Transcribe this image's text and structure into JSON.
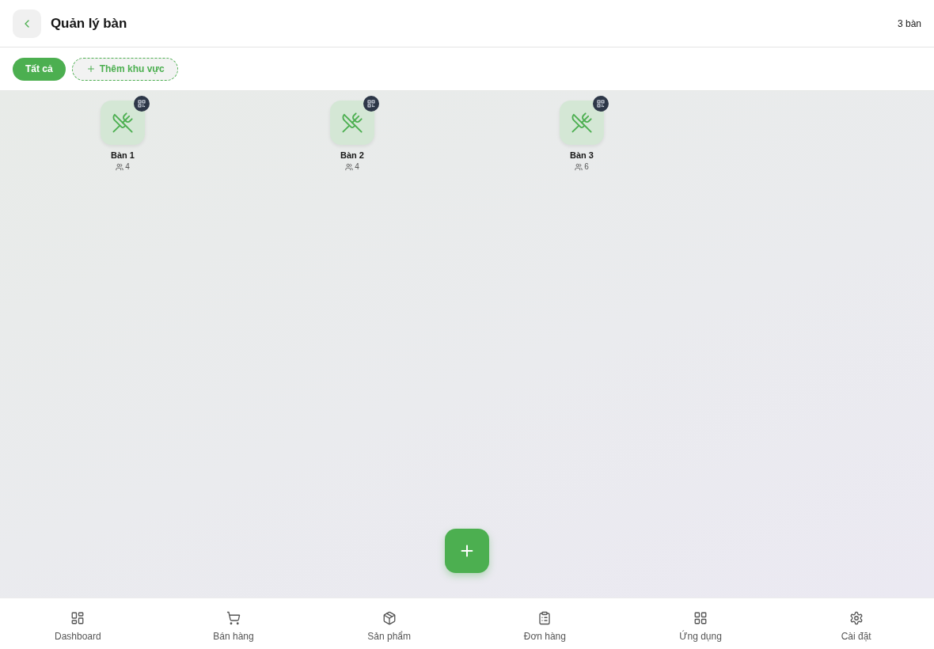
{
  "header": {
    "title": "Quản lý bàn",
    "table_count": "3 bàn"
  },
  "area_tabs": [
    {
      "label": "Tất cả",
      "selected": true
    }
  ],
  "add_area_button": {
    "label": "Thêm khu vực"
  },
  "tables": [
    {
      "name": "Bàn 1",
      "seats": "4"
    },
    {
      "name": "Bàn 2",
      "seats": "4"
    },
    {
      "name": "Bàn 3",
      "seats": "6"
    }
  ],
  "bottom_nav": [
    {
      "label": "Dashboard"
    },
    {
      "label": "Bán hàng"
    },
    {
      "label": "Sản phẩm"
    },
    {
      "label": "Đơn hàng"
    },
    {
      "label": "Ứng dụng"
    },
    {
      "label": "Cài đặt"
    }
  ]
}
